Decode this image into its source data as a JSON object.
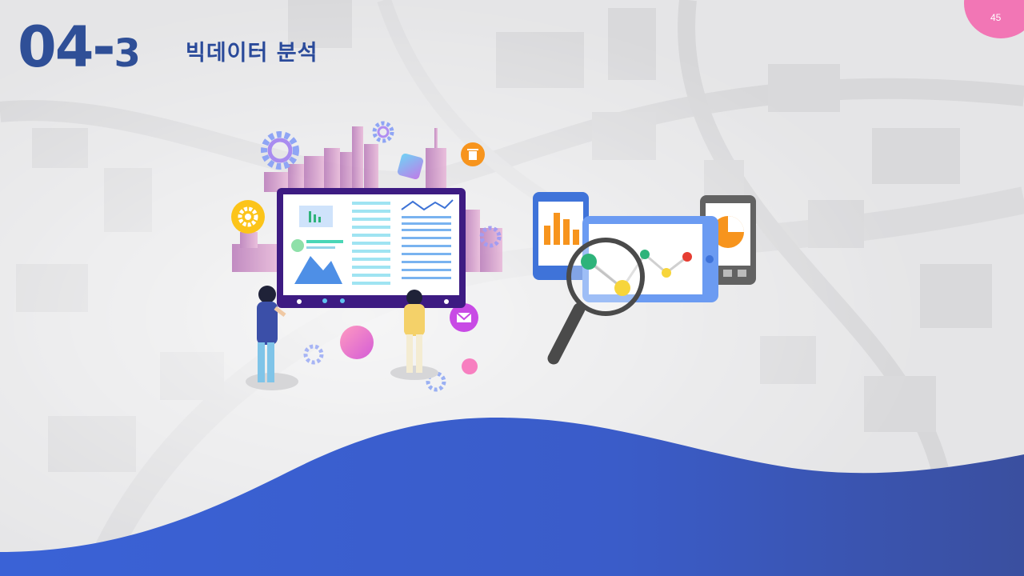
{
  "slide": {
    "section_major": "04-",
    "section_minor": "3",
    "title": "빅데이터 분석",
    "page_number": "45"
  },
  "colors": {
    "accent_blue": "#2f4f97",
    "wave_blue": "#3d5fcf",
    "badge_pink": "#f276b5"
  }
}
